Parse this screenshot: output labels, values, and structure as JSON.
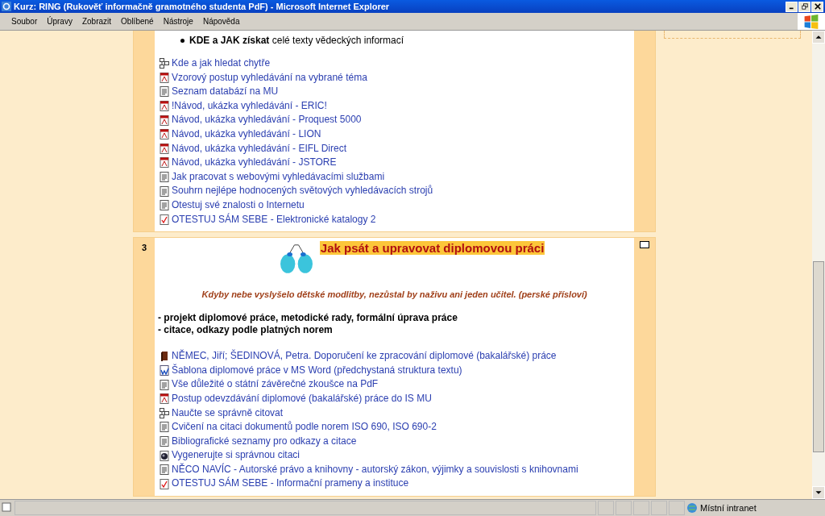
{
  "window": {
    "title": "Kurz: RING (Rukověť informačně gramotného studenta PdF) - Microsoft Internet Explorer"
  },
  "menu": [
    "Soubor",
    "Úpravy",
    "Zobrazit",
    "Oblíbené",
    "Nástroje",
    "Nápověda"
  ],
  "sections": [
    {
      "bullets": [
        "**KDE a JAK získat** celé texty vědeckých informací"
      ],
      "links": [
        {
          "kind": "outline",
          "text": "Kde a jak hledat chytře"
        },
        {
          "kind": "pdf",
          "text": "Vzorový postup vyhledávání na vybrané téma"
        },
        {
          "kind": "doc",
          "text": "Seznam databází na MU"
        },
        {
          "kind": "pdf",
          "text": "!Návod, ukázka vyhledávání - ERIC!"
        },
        {
          "kind": "pdf",
          "text": "Návod, ukázka vyhledávání - Proquest 5000"
        },
        {
          "kind": "pdf",
          "text": "Návod, ukázka vyhledávání - LION"
        },
        {
          "kind": "pdf",
          "text": "Návod, ukázka vyhledávání - EIFL Direct"
        },
        {
          "kind": "pdf",
          "text": "Návod, ukázka vyhledávání - JSTORE"
        },
        {
          "kind": "doc",
          "text": "Jak pracovat s webovými vyhledávacími službami"
        },
        {
          "kind": "doc",
          "text": "Souhrn nejlépe hodnocených světových vyhledávacích strojů"
        },
        {
          "kind": "doc",
          "text": "Otestuj své znalosti o Internetu"
        },
        {
          "kind": "quiz",
          "text": "OTESTUJ SÁM SEBE - Elektronické katalogy 2"
        }
      ]
    },
    {
      "number": "3",
      "title": "Jak psát a upravovat diplomovou práci",
      "quote": "Kdyby nebe vyslyšelo dětské modlitby, nezůstal by naživu ani jeden učitel. (perské přísloví)",
      "points": [
        "- projekt diplomové práce, metodické rady, formální úprava práce",
        "- citace, odkazy podle platných norem"
      ],
      "links": [
        {
          "kind": "book",
          "text": "NĚMEC, Jiří; ŠEDINOVÁ, Petra. Doporučení ke zpracování diplomové (bakalářské) práce"
        },
        {
          "kind": "word",
          "text": "Šablona diplomové práce v MS Word (předchystaná struktura textu)"
        },
        {
          "kind": "doc",
          "text": "Vše důležité o státní závěrečné zkoušce na PdF"
        },
        {
          "kind": "pdf",
          "text": "Postup odevzdávání diplomové (bakalářské) práce do IS MU"
        },
        {
          "kind": "outline",
          "text": "Naučte se správně citovat"
        },
        {
          "kind": "doc",
          "text": "Cvičení na citaci dokumentů podle norem ISO 690, ISO 690-2"
        },
        {
          "kind": "doc",
          "text": "Bibliografické seznamy pro odkazy a citace"
        },
        {
          "kind": "globe",
          "text": "Vygenerujte si správnou citaci"
        },
        {
          "kind": "doc",
          "text": "NĚCO NAVÍC - Autorské právo a knihovny - autorský zákon, výjimky a souvislosti s knihovnami"
        },
        {
          "kind": "quiz",
          "text": "OTESTUJ SÁM SEBE - Informační prameny a instituce"
        }
      ]
    }
  ],
  "status_bar": {
    "zone": "Místní intranet"
  }
}
